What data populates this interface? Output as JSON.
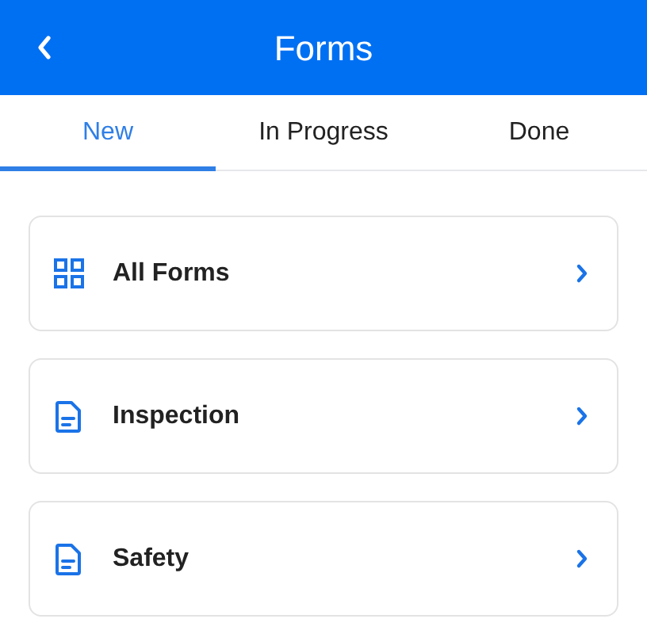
{
  "header": {
    "title": "Forms"
  },
  "tabs": [
    {
      "label": "New",
      "selected": true
    },
    {
      "label": "In Progress",
      "selected": false
    },
    {
      "label": "Done",
      "selected": false
    }
  ],
  "items": [
    {
      "label": "All Forms",
      "kind": "grid"
    },
    {
      "label": "Inspection",
      "kind": "document"
    },
    {
      "label": "Safety",
      "kind": "document"
    }
  ]
}
